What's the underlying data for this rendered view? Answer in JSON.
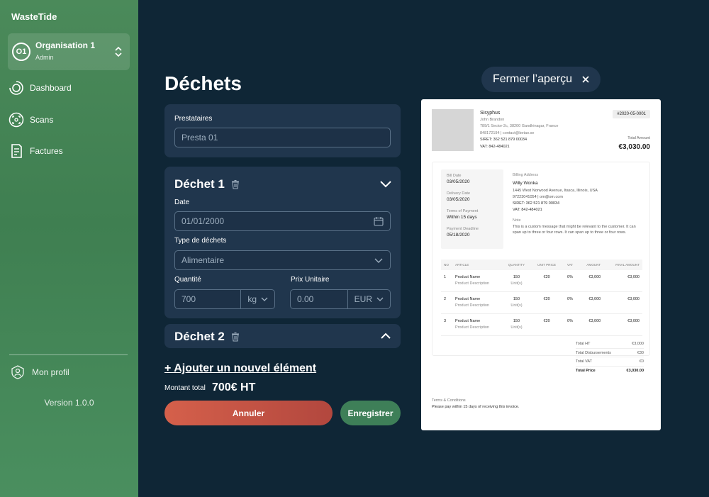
{
  "sidebar": {
    "brand": "WasteTide",
    "org": {
      "avatar": "O1",
      "name": "Organisation 1",
      "role": "Admin"
    },
    "items": [
      {
        "label": "Dashboard",
        "icon": "dashboard-icon"
      },
      {
        "label": "Scans",
        "icon": "scan-icon"
      },
      {
        "label": "Factures",
        "icon": "invoice-icon"
      }
    ],
    "profile": "Mon profil",
    "version": "Version 1.0.0"
  },
  "main": {
    "title": "Déchets",
    "providers": {
      "label": "Prestataires",
      "value": "Presta 01"
    },
    "waste1": {
      "title": "Déchet 1",
      "date_label": "Date",
      "date_value": "01/01/2000",
      "type_label": "Type de déchets",
      "type_value": "Alimentaire",
      "qty_label": "Quantité",
      "qty_value": "700",
      "qty_unit": "kg",
      "price_label": "Prix Unitaire",
      "price_placeholder": "0.00",
      "currency": "EUR"
    },
    "waste2": {
      "title": "Déchet 2"
    },
    "add_label": "+ Ajouter un nouvel élément",
    "total_label": "Montant total",
    "total_value": "700€ HT",
    "cancel_label": "Annuler",
    "save_label": "Enregistrer"
  },
  "preview": {
    "close_label": "Fermer l’aperçu",
    "invoice": {
      "company": "Sisyphus",
      "contact": "John Brandon",
      "address": "789/1 Sector-2c, 38200 Gandhinagar, France",
      "phone_email": "848172194 | contact@betao.se",
      "siret": "SIRET: 362 521 879 00034",
      "vat": "VAT: 842-484021",
      "number": "#2020-05-0001",
      "total_amount_label": "Total Amount",
      "total_amount": "€3,030.00",
      "bill_date_label": "Bill Date",
      "bill_date": "03/05/2020",
      "delivery_date_label": "Delivery Date",
      "delivery_date": "03/05/2020",
      "terms_payment_label": "Terms of Payment",
      "terms_payment": "Within 15 days",
      "deadline_label": "Payment Deadline",
      "deadline": "05/18/2020",
      "billing_label": "Billing Address",
      "billing_name": "Willy Wonka",
      "billing_address": "1445 West Norwood Avenue, Itasca, Illinois, USA",
      "billing_phone": "97223041054 | om@om.com",
      "billing_siret": "SIRET: 362 521 879 00034",
      "billing_vat": "VAT: 842-484021",
      "note_label": "Note",
      "note": "This is a custom message that might be relevant to the customer. It can span up to three or four rows. It can span up to three or four rows.",
      "columns": [
        "NO",
        "ARTICLE",
        "QUANTITY",
        "UNIT PRICE",
        "VAT",
        "AMOUNT",
        "FINAL AMOUNT"
      ],
      "rows": [
        {
          "no": "1",
          "name": "Product Name",
          "desc": "Product Description",
          "qty": "150",
          "unit": "Unit(s)",
          "price": "€20",
          "vat": "0%",
          "amount": "€3,000",
          "final": "€3,000"
        },
        {
          "no": "2",
          "name": "Product Name",
          "desc": "Product Description",
          "qty": "150",
          "unit": "Unit(s)",
          "price": "€20",
          "vat": "0%",
          "amount": "€3,000",
          "final": "€3,000"
        },
        {
          "no": "3",
          "name": "Product Name",
          "desc": "Product Description",
          "qty": "150",
          "unit": "Unit(s)",
          "price": "€20",
          "vat": "0%",
          "amount": "€3,000",
          "final": "€3,000"
        }
      ],
      "sums": [
        {
          "label": "Total HT",
          "value": "€3,000"
        },
        {
          "label": "Total Disbursements",
          "value": "€30"
        },
        {
          "label": "Total VAT",
          "value": "€0"
        },
        {
          "label": "Total Price",
          "value": "€3,030.00"
        }
      ],
      "terms_label": "Terms & Conditions",
      "terms": "Please pay within 15 days of receiving this invoice."
    }
  },
  "colors": {
    "bg": "#0f2636",
    "card": "#20364d",
    "sidebar": "#4b8a5a",
    "cancel": "#d5604b",
    "save": "#3e7f58"
  }
}
